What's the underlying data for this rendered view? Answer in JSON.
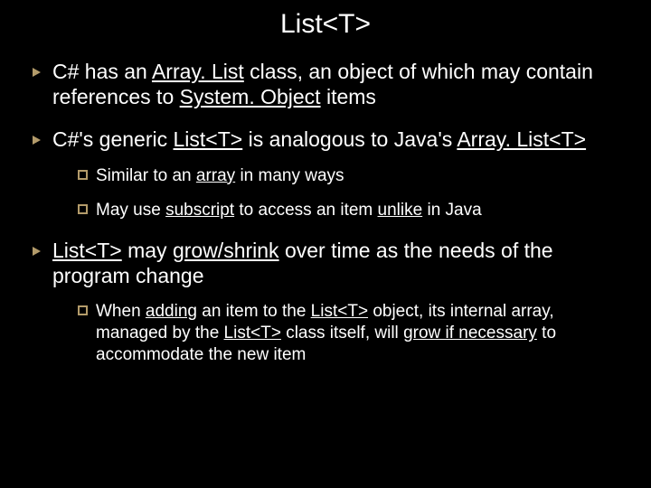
{
  "title": "List<T>",
  "bullets": {
    "b1": "C# has an <span class=\"u\">Array. List</span> class, an object of which may contain references to <span class=\"u\">System. Object</span> items",
    "b2": "C#'s generic <span class=\"u\">List<T></span> is analogous to Java's <span class=\"u\">Array. List<T></span>",
    "b2s1": "Similar to an <span class=\"u\">array</span> in many ways",
    "b2s2": "May use <span class=\"u\">subscript</span> to access an item <span class=\"u\">unlike</span> in Java",
    "b3": "<span class=\"u\">List<T></span> may <span class=\"u\">grow/shrink</span> over time as the needs of the program change",
    "b3s1": "When <span class=\"u\">adding</span> an item to the <span class=\"u\">List<T></span> object, its internal array, managed by the <span class=\"u\">List<T></span> class itself, will <span class=\"u\">grow if necessary</span> to accommodate the new item"
  }
}
